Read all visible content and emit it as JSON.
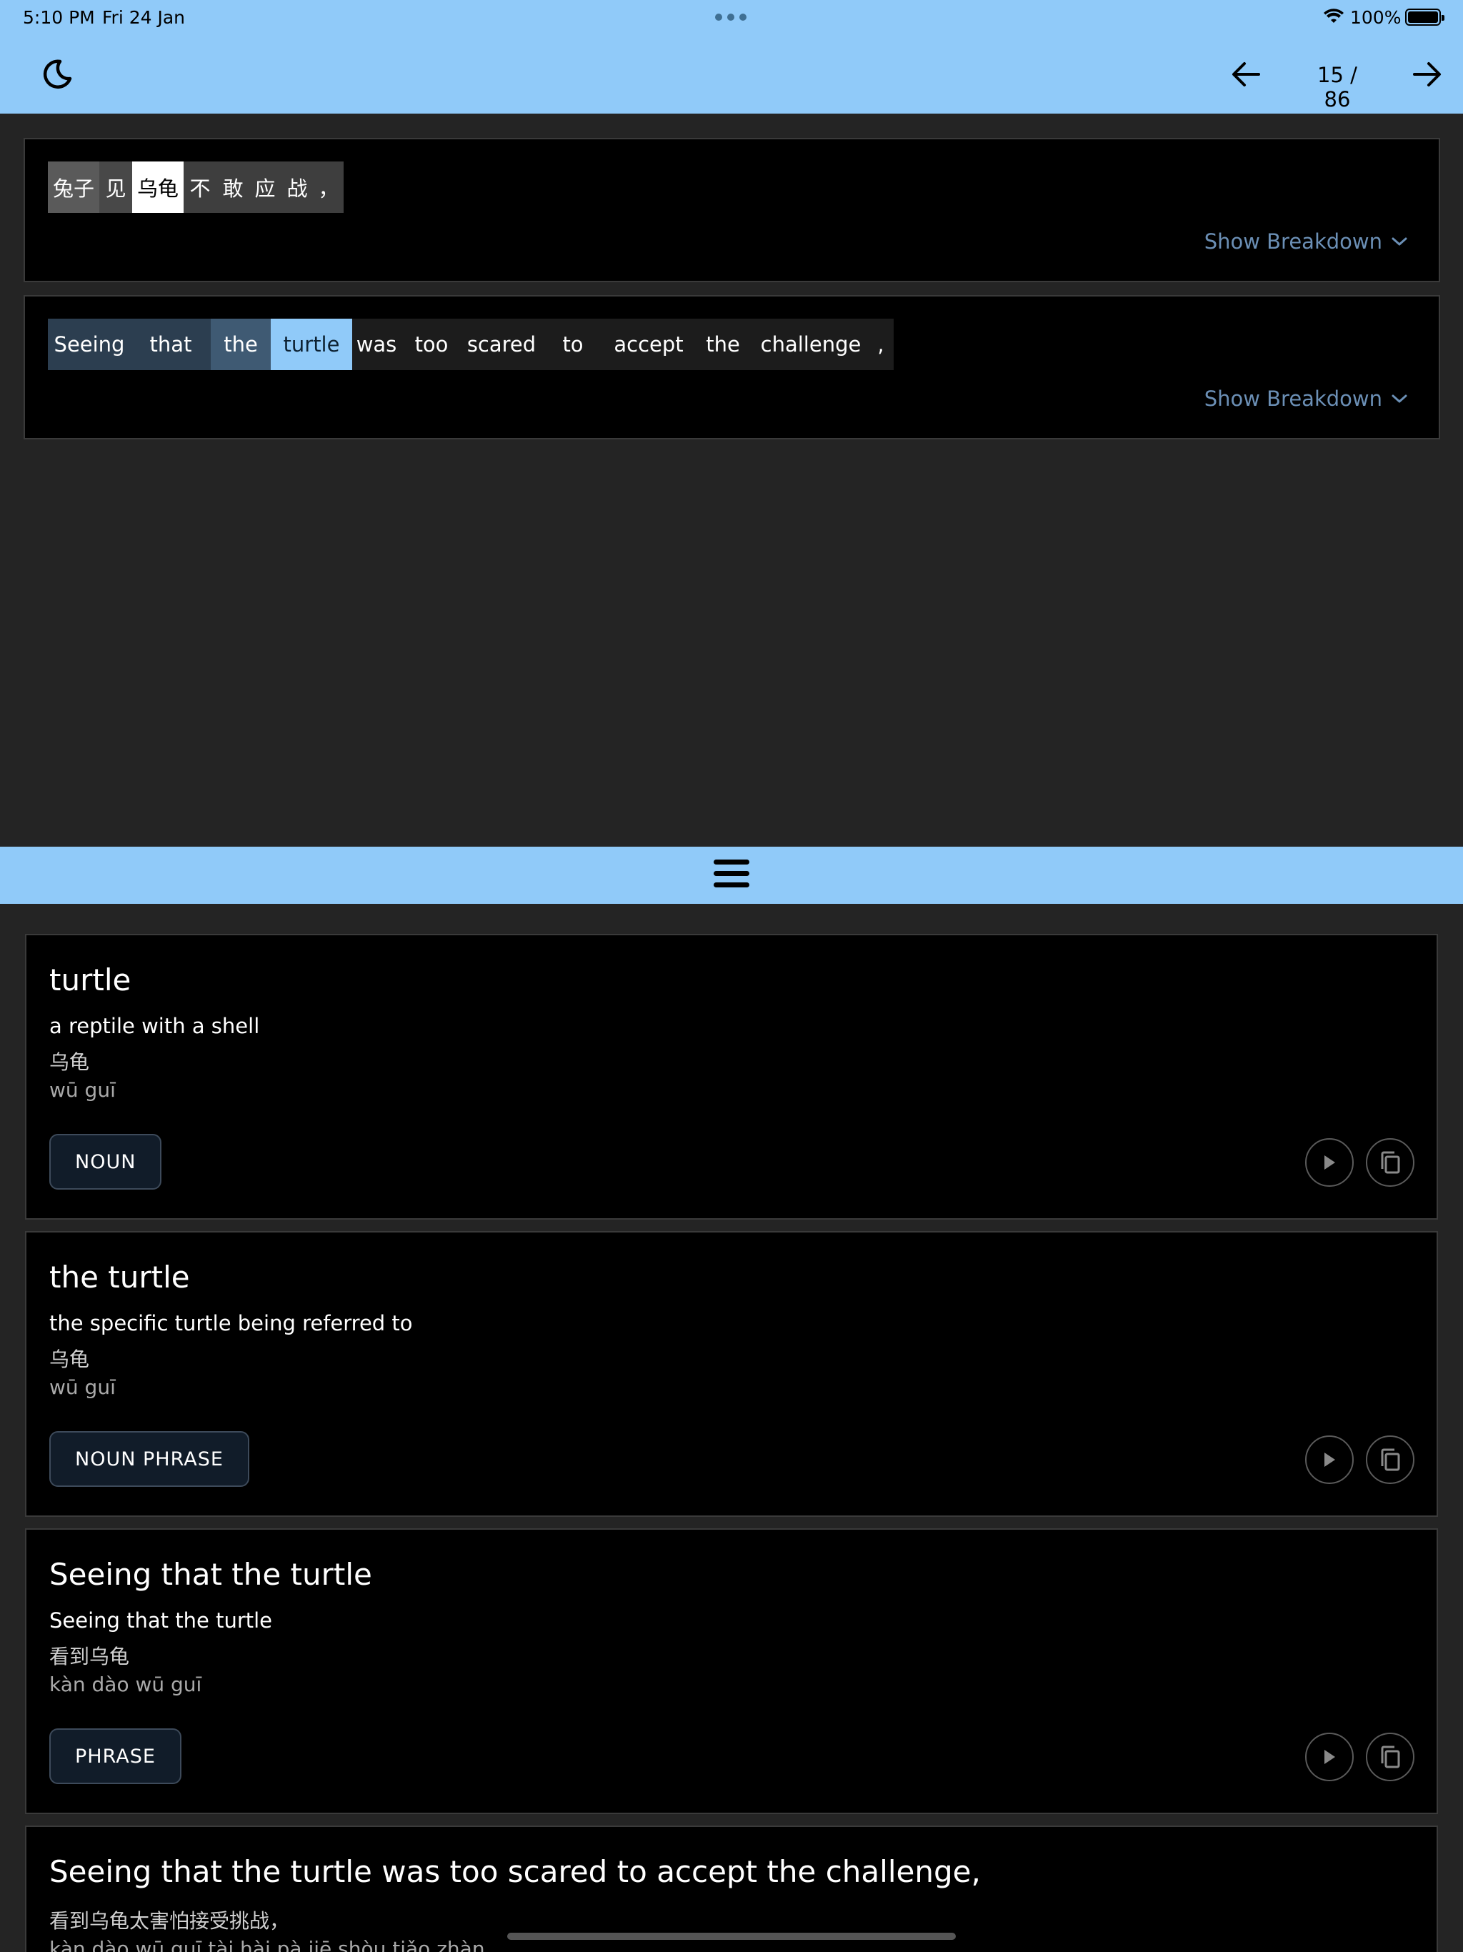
{
  "status_bar": {
    "time": "5:10 PM",
    "date": "Fri 24 Jan",
    "battery": "100%"
  },
  "header": {
    "page_counter": "15 / 86"
  },
  "sentence_source": {
    "tokens": [
      "兔子",
      "见",
      "乌龟",
      "不",
      "敢",
      "应",
      "战",
      "，"
    ],
    "breakdown_label": "Show Breakdown"
  },
  "sentence_translation": {
    "tokens": [
      "Seeing",
      "that",
      "the",
      "turtle",
      "was",
      "too",
      "scared",
      "to",
      "accept",
      "the",
      "challenge",
      ","
    ],
    "breakdown_label": "Show Breakdown"
  },
  "entries": [
    {
      "word": "turtle",
      "definition": "a reptile with a shell",
      "chinese": "乌龟",
      "pinyin": "wū guī",
      "pos": "NOUN"
    },
    {
      "word": "the turtle",
      "definition": "the specific turtle being referred to",
      "chinese": "乌龟",
      "pinyin": "wū guī",
      "pos": "NOUN PHRASE"
    },
    {
      "word": "Seeing that the turtle",
      "definition": "Seeing that the turtle",
      "chinese": "看到乌龟",
      "pinyin": "kàn dào wū guī",
      "pos": "PHRASE"
    },
    {
      "word": "Seeing that the turtle was too scared to accept the challenge,",
      "chinese": "看到乌龟太害怕接受挑战，",
      "pinyin": "kàn dào wū guī tài hài pà jiē shòu tiǎo zhàn."
    }
  ],
  "colors": {
    "accent": "#90CAF9",
    "highlight": "#90CAF9",
    "background": "#242424"
  }
}
